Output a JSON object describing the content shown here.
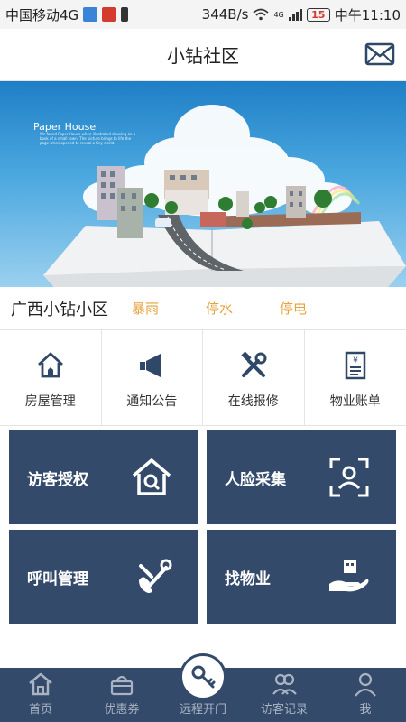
{
  "status_bar": {
    "carrier": "中国移动4G",
    "speed": "344B/s",
    "network": "4G",
    "battery": "15",
    "time": "中午11:10"
  },
  "header": {
    "title": "小钻社区",
    "mail_icon": "mail-icon"
  },
  "banner": {
    "brand": "Paper House",
    "caption": "We found Paper House when illustrated drawing on a book of a small town. The picture brings to life the page when opened to reveal a tiny world."
  },
  "community": {
    "name": "广西小钻小区",
    "notices": [
      "暴雨",
      "停水",
      "停电"
    ]
  },
  "quick_actions": [
    {
      "label": "房屋管理",
      "icon": "house-icon"
    },
    {
      "label": "通知公告",
      "icon": "megaphone-icon"
    },
    {
      "label": "在线报修",
      "icon": "tools-icon"
    },
    {
      "label": "物业账单",
      "icon": "bill-icon"
    }
  ],
  "tiles": [
    {
      "label": "访客授权",
      "icon": "house-search-icon"
    },
    {
      "label": "人脸采集",
      "icon": "face-scan-icon"
    },
    {
      "label": "呼叫管理",
      "icon": "phone-wrench-icon"
    },
    {
      "label": "找物业",
      "icon": "hand-building-icon"
    }
  ],
  "tabbar": [
    {
      "label": "首页",
      "icon": "home-icon"
    },
    {
      "label": "优惠券",
      "icon": "basket-icon"
    },
    {
      "label": "远程开门",
      "icon": "key-icon"
    },
    {
      "label": "访客记录",
      "icon": "visitors-icon"
    },
    {
      "label": "我",
      "icon": "person-icon"
    }
  ],
  "colors": {
    "tile_bg": "#334a6b",
    "notice": "#e6a23c",
    "tab_text": "#aab3c2"
  }
}
